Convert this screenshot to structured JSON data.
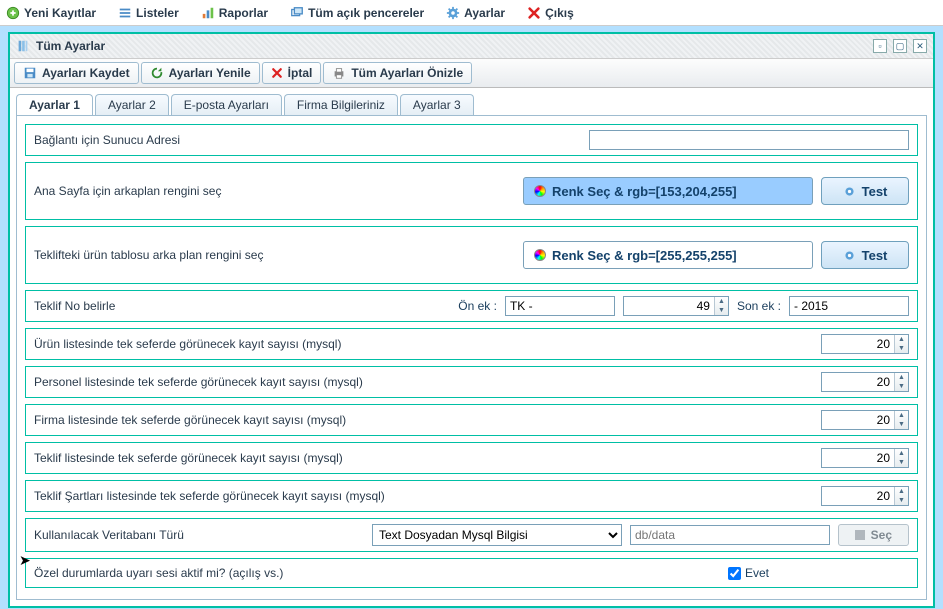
{
  "menubar": {
    "items": [
      {
        "label": "Yeni Kayıtlar",
        "icon": "plus-circle"
      },
      {
        "label": "Listeler",
        "icon": "list"
      },
      {
        "label": "Raporlar",
        "icon": "bar-chart"
      },
      {
        "label": "Tüm açık pencereler",
        "icon": "windows"
      },
      {
        "label": "Ayarlar",
        "icon": "gear"
      },
      {
        "label": "Çıkış",
        "icon": "close"
      }
    ]
  },
  "window": {
    "title": "Tüm Ayarlar"
  },
  "toolbar": {
    "save": "Ayarları Kaydet",
    "refresh": "Ayarları Yenile",
    "cancel": "İptal",
    "preview": "Tüm Ayarları Önizle"
  },
  "tabs": [
    "Ayarlar 1",
    "Ayarlar 2",
    "E-posta Ayarları",
    "Firma Bilgileriniz",
    "Ayarlar 3"
  ],
  "fields": {
    "server_addr_label": "Bağlantı için Sunucu Adresi",
    "server_addr_value": "",
    "homepage_bg_label": "Ana Sayfa için arkaplan rengini seç",
    "homepage_bg_button": "Renk Seç  &  rgb=[153,204,255]",
    "offer_bg_label": "Teklifteki ürün tablosu arka plan rengini seç",
    "offer_bg_button": "Renk Seç  &  rgb=[255,255,255]",
    "test_label": "Test",
    "offer_no_label": "Teklif No belirle",
    "prefix_label": "Ön ek :",
    "prefix_value": "TK -",
    "counter_value": "49",
    "suffix_label": "Son ek :",
    "suffix_value": "- 2015",
    "urun_list_label": "Ürün listesinde tek seferde görünecek kayıt sayısı (mysql)",
    "urun_list_value": "20",
    "personel_list_label": "Personel listesinde tek seferde görünecek kayıt sayısı (mysql)",
    "personel_list_value": "20",
    "firma_list_label": "Firma listesinde tek seferde görünecek kayıt sayısı (mysql)",
    "firma_list_value": "20",
    "teklif_list_label": "Teklif listesinde tek seferde görünecek kayıt sayısı (mysql)",
    "teklif_list_value": "20",
    "teklif_sart_label": "Teklif Şartları listesinde tek seferde görünecek kayıt sayısı (mysql)",
    "teklif_sart_value": "20",
    "db_type_label": "Kullanılacak Veritabanı Türü",
    "db_type_value": "Text Dosyadan Mysql Bilgisi",
    "db_path_placeholder": "db/data",
    "db_select_label": "Seç",
    "alert_sound_label": "Özel durumlarda uyarı sesi aktif mi? (açılış vs.)",
    "alert_sound_check": "Evet"
  }
}
